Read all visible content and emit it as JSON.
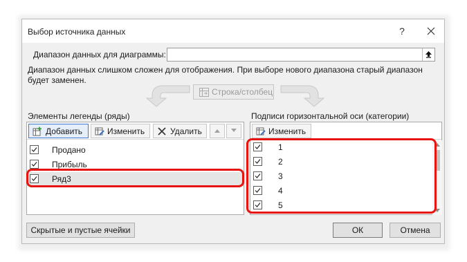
{
  "dialog": {
    "title": "Выбор источника данных",
    "help": "?",
    "close": "✕"
  },
  "range": {
    "label": "Диапазон данных для диаграммы:",
    "value": "",
    "warning": "Диапазон данных слишком сложен для отображения. При выборе нового диапазона старый диапазон будет заменен."
  },
  "switch_label": "Строка/столбец",
  "legend": {
    "label": "Элементы легенды (ряды)",
    "add_label": "Добавить",
    "edit_label": "Изменить",
    "delete_label": "Удалить",
    "items": [
      {
        "label": "Продано",
        "checked": true
      },
      {
        "label": "Прибыль",
        "checked": true
      },
      {
        "label": "Ряд3",
        "checked": true
      }
    ]
  },
  "axis": {
    "label": "Подписи горизонтальной оси (категории)",
    "edit_label": "Изменить",
    "items": [
      {
        "label": "1",
        "checked": true
      },
      {
        "label": "2",
        "checked": true
      },
      {
        "label": "3",
        "checked": true
      },
      {
        "label": "4",
        "checked": true
      },
      {
        "label": "5",
        "checked": true
      }
    ]
  },
  "footer": {
    "hidden_cells_label": "Скрытые и пустые ячейки",
    "ok_label": "ОК",
    "cancel_label": "Отмена"
  },
  "colors": {
    "highlight": "#e8130f",
    "focus": "#3a78d4"
  }
}
